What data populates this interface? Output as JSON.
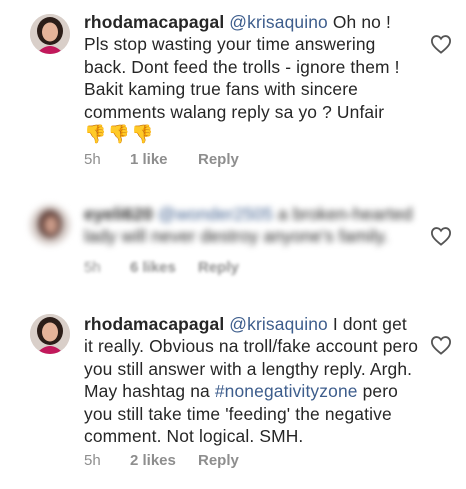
{
  "comments": [
    {
      "username": "rhodamacapagal",
      "mention": "@krisaquino",
      "text": " Oh no ! Pls stop wasting your time answering back. Dont feed the trolls - ignore them ! Bakit kaming true fans with sincere comments walang reply sa yo ? Unfair ",
      "emoji": [
        "👎",
        "👎",
        "👎"
      ],
      "time": "5h",
      "likes": "1 like",
      "reply": "Reply"
    },
    {
      "username": "eyeli620",
      "mention": "@wonder2505",
      "text": " a broken-hearted lady will never destroy anyone's family.",
      "time": "5h",
      "likes": "6 likes",
      "reply": "Reply"
    },
    {
      "username": "rhodamacapagal",
      "mention": "@krisaquino",
      "text_before": " I dont get it really. Obvious na troll/fake account pero you still answer with a lengthy reply. Argh. May hashtag na ",
      "hashtag": "#nonegativityzone",
      "text_after": " pero you still take time 'feeding' the negative comment. Not logical. SMH.",
      "time": "5h",
      "likes": "2 likes",
      "reply": "Reply"
    }
  ],
  "colors": {
    "mention": "#3d5d8c",
    "meta": "#8e8e8e",
    "text": "#262626",
    "emoji": "#f0ad00"
  },
  "icons": [
    "heart-outline-icon",
    "thumbs-down-emoji"
  ]
}
